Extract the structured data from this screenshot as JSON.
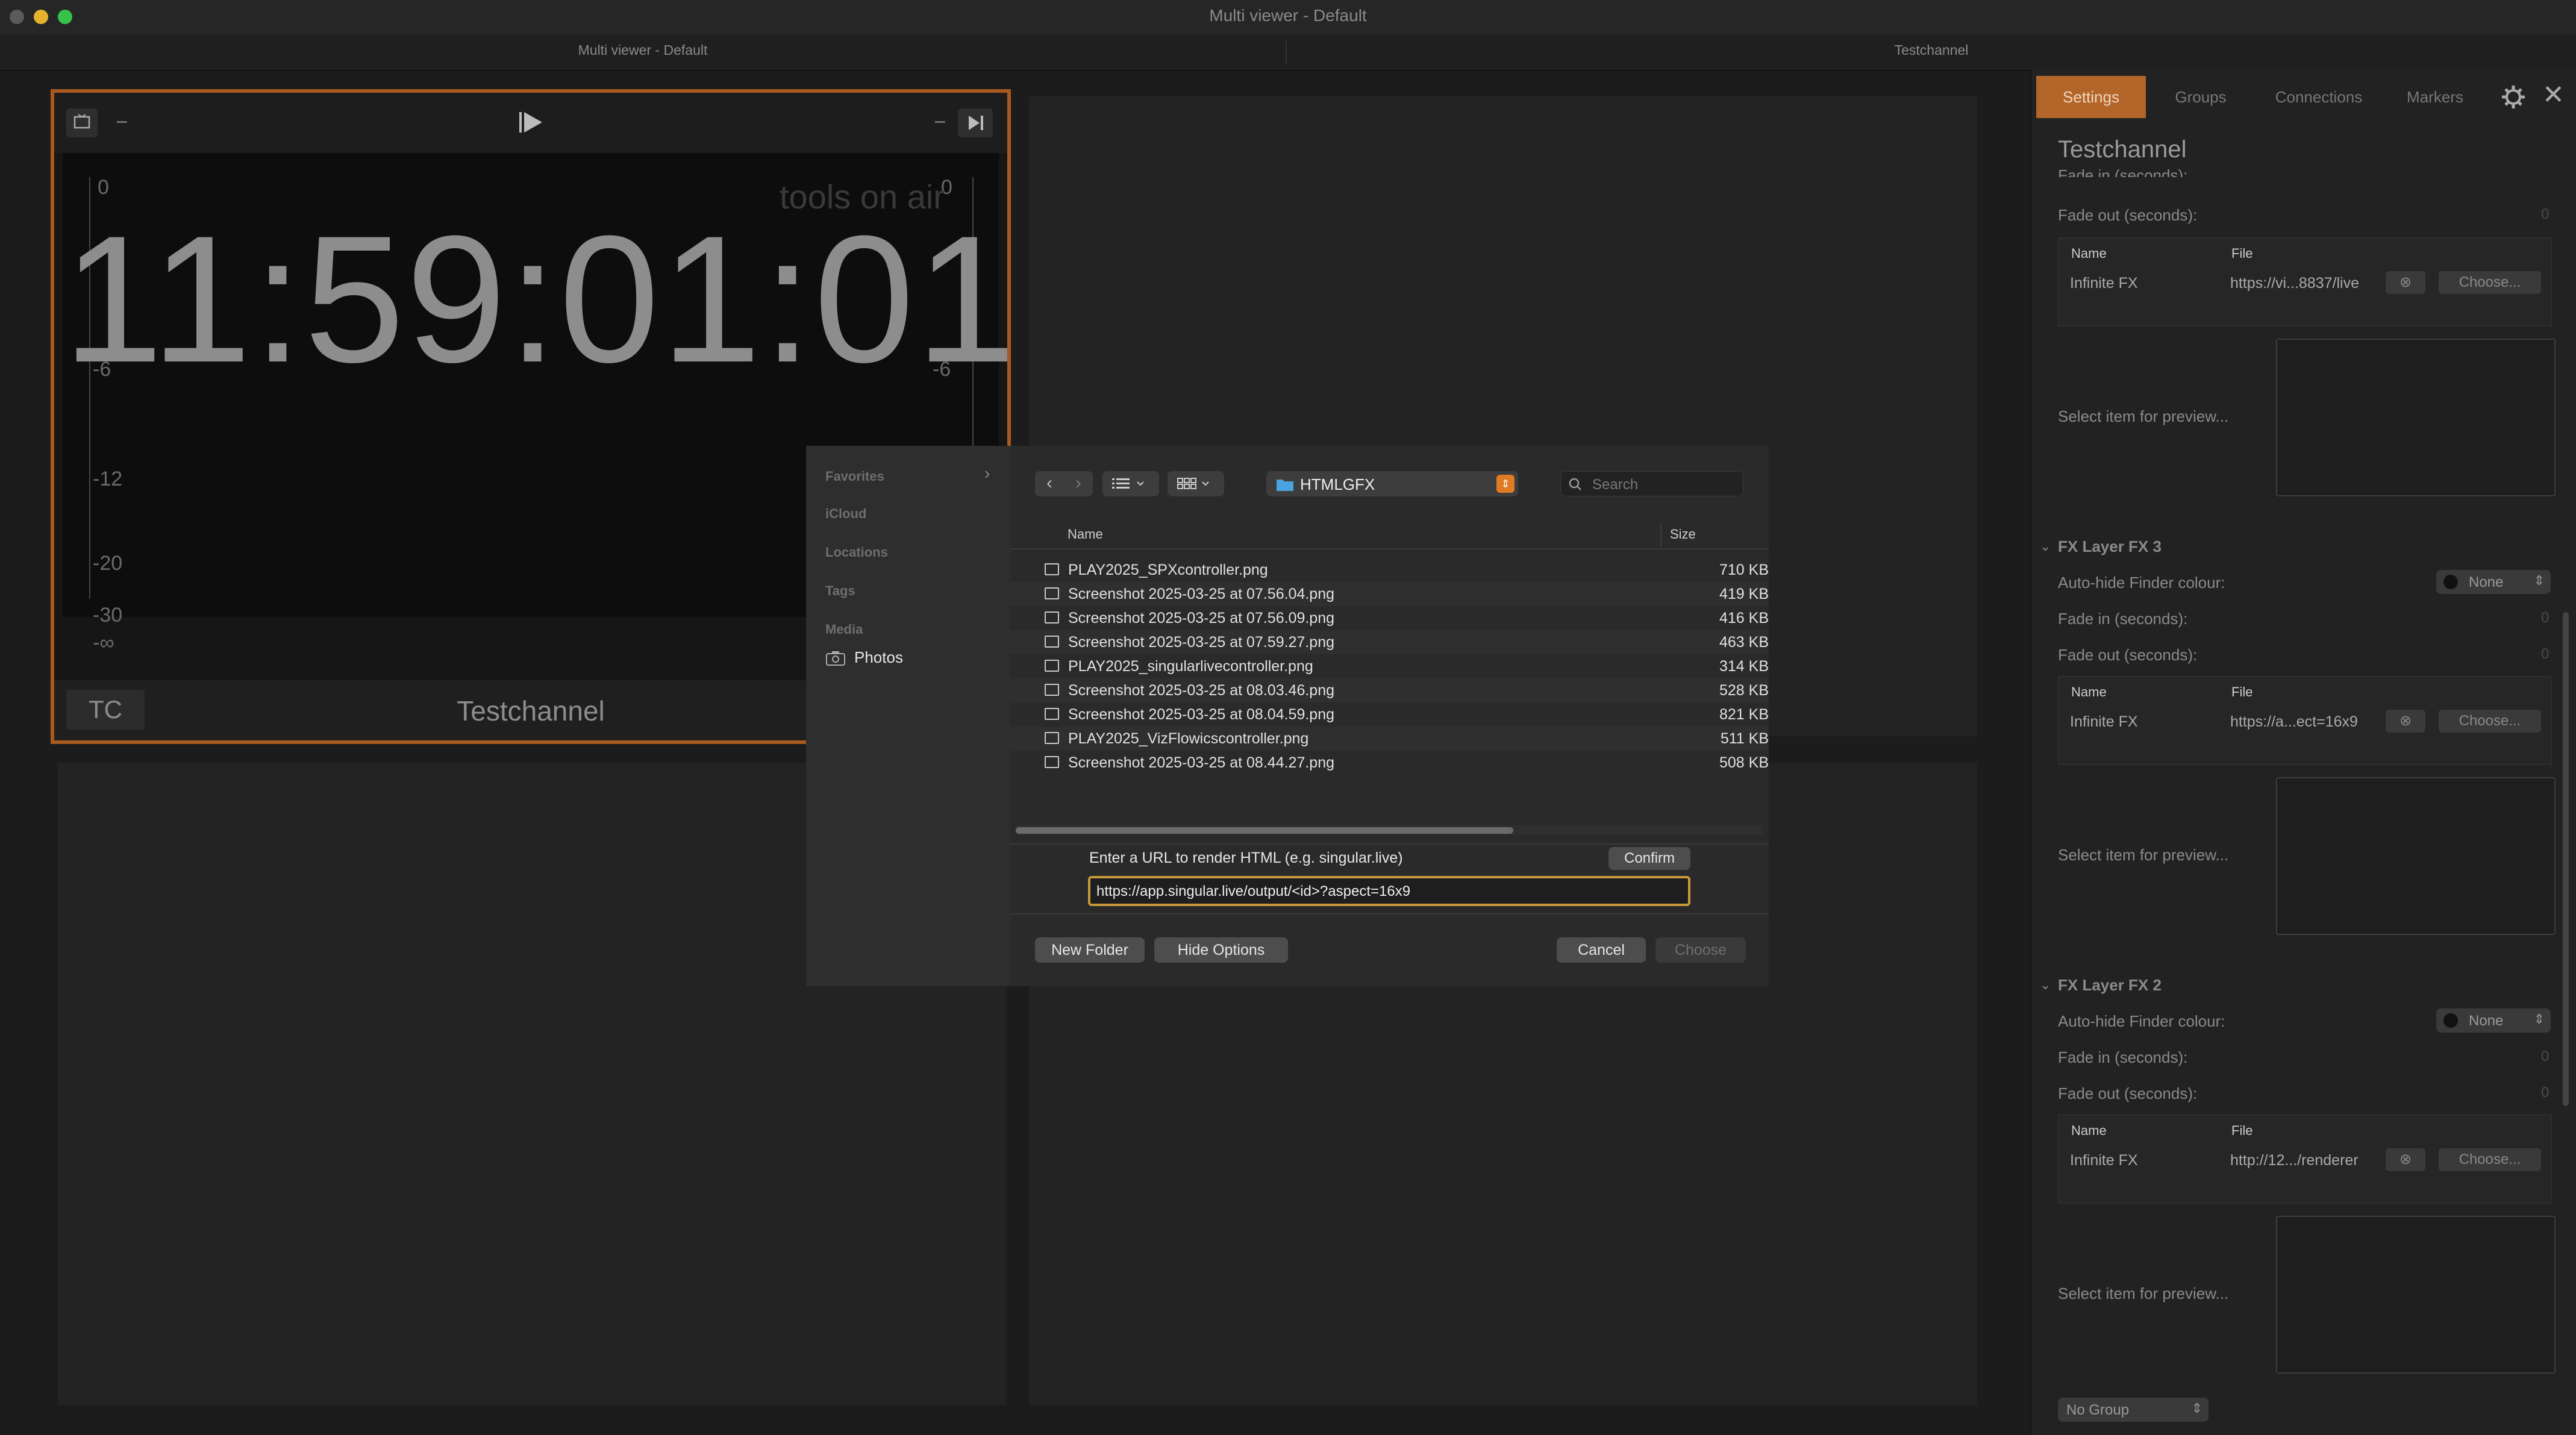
{
  "window": {
    "title": "Multi viewer - Default"
  },
  "tabs": [
    "Multi viewer - Default",
    "Testchannel"
  ],
  "viewer": {
    "toolbar_dash_left": "–",
    "toolbar_dash_right": "–",
    "clock": "11:59:01:01",
    "watermark": "tools on air",
    "meter_left": [
      "0",
      "-6",
      "-12",
      "-20",
      "-30",
      "-∞"
    ],
    "meter_right": [
      "0",
      "-6"
    ],
    "tc_label": "TC",
    "channel_name": "Testchannel"
  },
  "dialog": {
    "sidebar": {
      "favorites": "Favorites",
      "icloud": "iCloud",
      "locations": "Locations",
      "tags": "Tags",
      "media": "Media",
      "photos": "Photos"
    },
    "folder": "HTMLGFX",
    "search_placeholder": "Search",
    "col_name": "Name",
    "col_size": "Size",
    "files": [
      {
        "name": "PLAY2025_SPXcontroller.png",
        "size": "710 KB"
      },
      {
        "name": "Screenshot 2025-03-25 at 07.56.04.png",
        "size": "419 KB"
      },
      {
        "name": "Screenshot 2025-03-25 at 07.56.09.png",
        "size": "416 KB"
      },
      {
        "name": "Screenshot 2025-03-25 at 07.59.27.png",
        "size": "463 KB"
      },
      {
        "name": "PLAY2025_singularlivecontroller.png",
        "size": "314 KB"
      },
      {
        "name": "Screenshot 2025-03-25 at 08.03.46.png",
        "size": "528 KB"
      },
      {
        "name": "Screenshot 2025-03-25 at 08.04.59.png",
        "size": "821 KB"
      },
      {
        "name": "PLAY2025_VizFlowicscontroller.png",
        "size": "511 KB"
      },
      {
        "name": "Screenshot 2025-03-25 at 08.44.27.png",
        "size": "508 KB"
      }
    ],
    "url_prompt": "Enter a URL to render HTML (e.g. singular.live)",
    "confirm": "Confirm",
    "url_value": "https://app.singular.live/output/<id>?aspect=16x9",
    "new_folder": "New Folder",
    "hide_options": "Hide Options",
    "cancel": "Cancel",
    "choose": "Choose"
  },
  "panel": {
    "tabs": [
      "Settings",
      "Groups",
      "Connections",
      "Markers"
    ],
    "channel_title": "Testchannel",
    "fade_in_label": "Fade in (seconds):",
    "fade_out_label": "Fade out (seconds):",
    "zero": "0",
    "col_name": "Name",
    "col_file": "File",
    "item_name": "Infinite FX",
    "choose_btn": "Choose...",
    "preview_hint": "Select item for preview...",
    "autohide_label": "Auto-hide Finder colour:",
    "none": "None",
    "layer0": {
      "file": "https://vi...8837/live"
    },
    "layer3": {
      "title": "FX Layer FX 3",
      "file": "https://a...ect=16x9"
    },
    "layer2": {
      "title": "FX Layer FX 2",
      "file": "http://12.../renderer"
    },
    "group_select": "No Group"
  },
  "colors": {
    "accent": "#a85a1e",
    "active_tab": "#b4662a",
    "url_border": "#c79a3c"
  }
}
